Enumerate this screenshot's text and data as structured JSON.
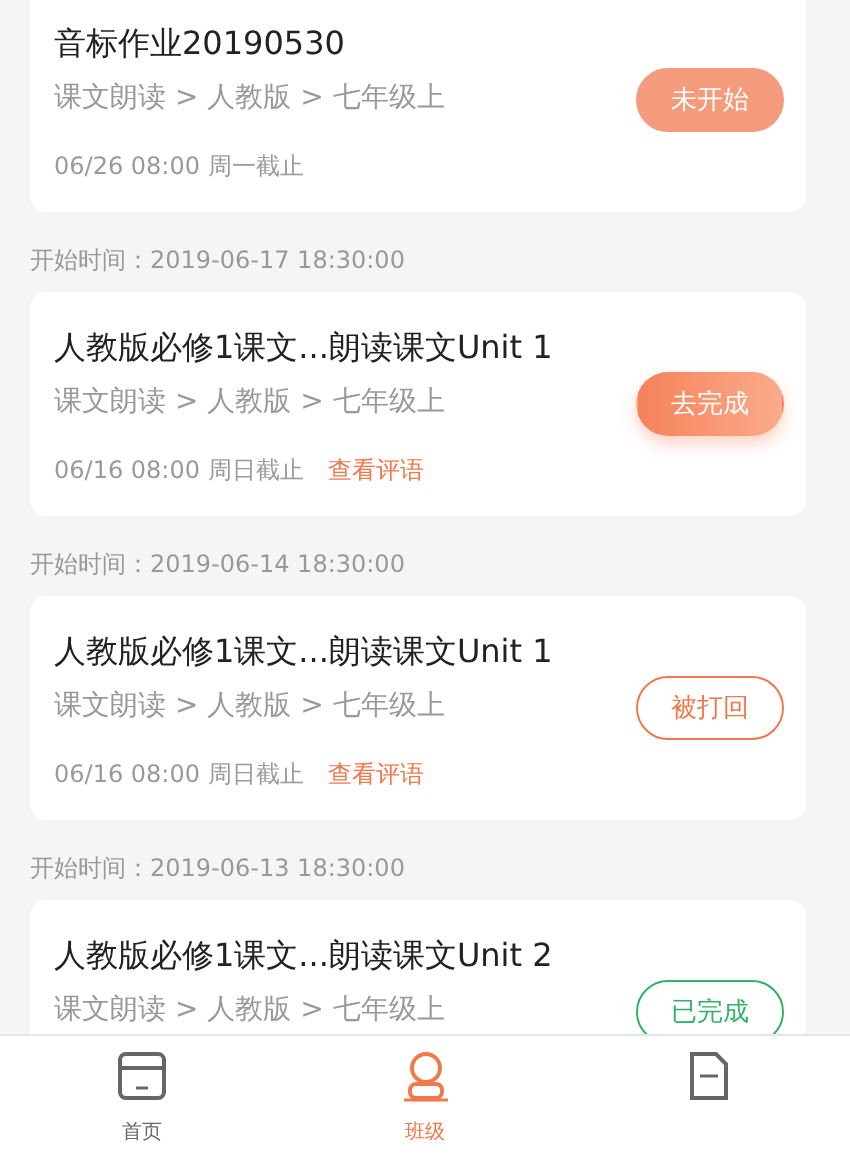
{
  "tasks": [
    {
      "title": "音标作业20190530",
      "path": "课文朗读 > 人教版 > 七年级上",
      "deadline": "06/26 08:00 周一截止",
      "status": {
        "label": "未开始",
        "kind": "not_started"
      }
    },
    {
      "start_time": "开始时间：2019-06-17 18:30:00",
      "title": "人教版必修1课文...朗读课文Unit 1",
      "path": "课文朗读 > 人教版 > 七年级上",
      "deadline": "06/16 08:00 周日截止",
      "link": "查看评语",
      "status": {
        "label": "去完成",
        "kind": "todo"
      }
    },
    {
      "start_time": "开始时间：2019-06-14 18:30:00",
      "title": "人教版必修1课文...朗读课文Unit 1",
      "path": "课文朗读 > 人教版 > 七年级上",
      "deadline": "06/16 08:00 周日截止",
      "link": "查看评语",
      "status": {
        "label": "被打回",
        "kind": "rejected"
      }
    },
    {
      "start_time": "开始时间：2019-06-13 18:30:00",
      "title": "人教版必修1课文...朗读课文Unit 2",
      "path": "课文朗读 > 人教版 > 七年级上",
      "status": {
        "label": "已完成",
        "kind": "done"
      }
    }
  ],
  "nav": [
    {
      "label": "首页",
      "kind": "home",
      "selected": false
    },
    {
      "label": "班级",
      "kind": "class",
      "selected": true
    },
    {
      "kind": "other",
      "selected": false
    }
  ]
}
